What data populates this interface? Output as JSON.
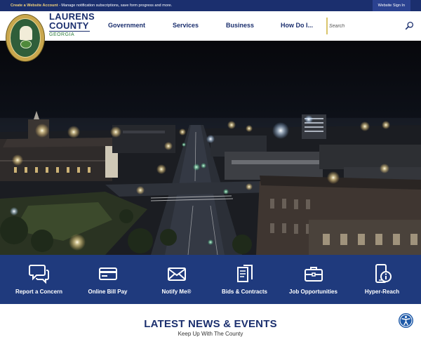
{
  "topbar": {
    "link_text": "Create a Website Account",
    "notice_text": " - Manage notification subscriptions, save form progress and more.",
    "signin_label": "Website Sign In"
  },
  "header": {
    "brand_line1": "LAURENS",
    "brand_line2": "COUNTY",
    "brand_line3": "GEORGIA",
    "nav": [
      "Government",
      "Services",
      "Business",
      "How Do I..."
    ],
    "search_placeholder": "Search"
  },
  "quick_links": [
    {
      "label": "Report a Concern",
      "icon": "chat-bubbles-icon"
    },
    {
      "label": "Online Bill Pay",
      "icon": "credit-card-icon"
    },
    {
      "label": "Notify Me®",
      "icon": "envelope-icon"
    },
    {
      "label": "Bids & Contracts",
      "icon": "documents-icon"
    },
    {
      "label": "Job Opportunities",
      "icon": "briefcase-icon"
    },
    {
      "label": "Hyper-Reach",
      "icon": "phone-alert-icon"
    }
  ],
  "news": {
    "title": "LATEST NEWS & EVENTS",
    "subtitle": "Keep Up With The County"
  },
  "colors": {
    "brand_navy": "#1b2f6e",
    "quick_links_bg": "#1f3a7d",
    "brand_green": "#2c7d3d",
    "accent_gold": "#d9c56b"
  }
}
